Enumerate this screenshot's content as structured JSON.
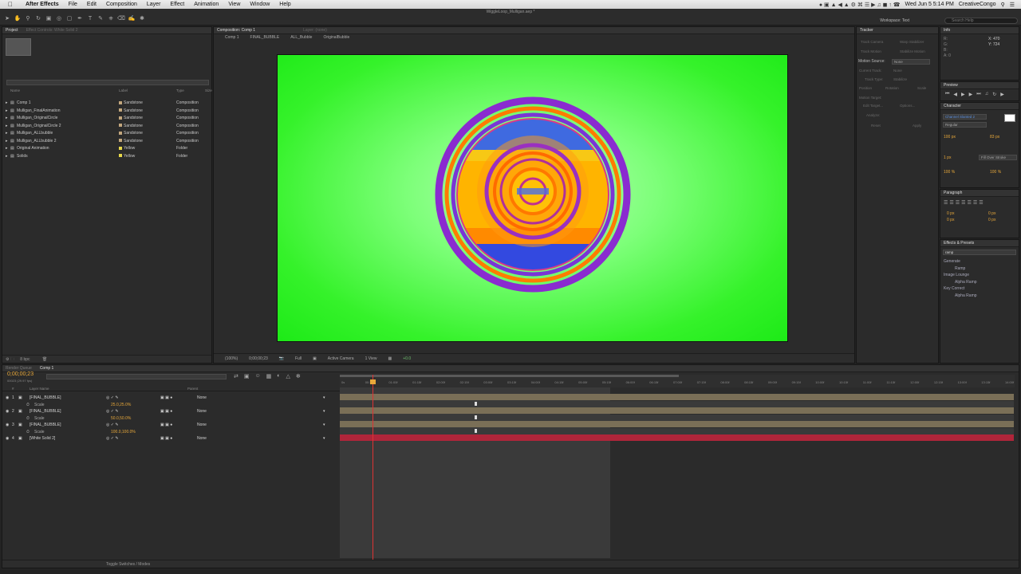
{
  "menubar": {
    "app_name": "After Effects",
    "items": [
      "File",
      "Edit",
      "Composition",
      "Layer",
      "Effect",
      "Animation",
      "View",
      "Window",
      "Help"
    ],
    "clock": "Wed Jun 5 5:14 PM",
    "user": "CreativeCongo"
  },
  "toolbar": {
    "file_title": "WiggleLoop_Mulligan.aep *",
    "workspace_label": "Workspace:",
    "workspace_value": "Text",
    "search_placeholder": "Search Help"
  },
  "project": {
    "tabs": [
      "Project",
      "Effect Controls: White Solid 2"
    ],
    "columns": [
      "Name",
      "Label",
      "Type",
      "Size"
    ],
    "items": [
      {
        "name": "Comp 1",
        "label": "Sandstone",
        "type": "Composition",
        "color": "#c3a77d"
      },
      {
        "name": "Mulligan_FinalAnimation",
        "label": "Sandstone",
        "type": "Composition",
        "color": "#c3a77d"
      },
      {
        "name": "Mulligan_OriginalCircle",
        "label": "Sandstone",
        "type": "Composition",
        "color": "#c3a77d"
      },
      {
        "name": "Mulligan_OriginalCircle 2",
        "label": "Sandstone",
        "type": "Composition",
        "color": "#c3a77d"
      },
      {
        "name": "Mulligan_ALLbubble",
        "label": "Sandstone",
        "type": "Composition",
        "color": "#c3a77d"
      },
      {
        "name": "Mulligan_ALLbubble 2",
        "label": "Sandstone",
        "type": "Composition",
        "color": "#c3a77d"
      },
      {
        "name": "Original Animation",
        "label": "Yellow",
        "type": "Folder",
        "color": "#e8d84a"
      },
      {
        "name": "Solids",
        "label": "Yellow",
        "type": "Folder",
        "color": "#e8d84a"
      }
    ],
    "footer_bpc": "8 bpc"
  },
  "composition": {
    "tabs": [
      "Composition: Comp 1",
      "Layer: (none)"
    ],
    "breadcrumbs": [
      "Comp 1",
      "FINAL_BUBBLE",
      "ALL_Bubble",
      "OriginalBubble"
    ],
    "zoom": "(100%)",
    "timecode": "0;00;00;23",
    "resolution": "Full",
    "camera": "Active Camera",
    "views": "1 View",
    "exposure": "+0.0",
    "bg_color": "#2ff023"
  },
  "tracker": {
    "title": "Tracker",
    "buttons": [
      "Track Camera",
      "Warp Stabilizer",
      "Track Motion",
      "Stabilize Motion"
    ],
    "motion_source_label": "Motion Source:",
    "motion_source_value": "None",
    "current_track_label": "Current Track:",
    "current_track_value": "None",
    "track_type_label": "Track Type:",
    "track_type_value": "Stabilize",
    "checks": [
      "Position",
      "Rotation",
      "Scale"
    ],
    "motion_target": "Motion Target:",
    "edit_target": "Edit Target...",
    "options": "Options...",
    "analyze": "Analyze:",
    "reset": "Reset",
    "apply": "Apply"
  },
  "info": {
    "title": "Info",
    "x": "X: 470",
    "y": "Y: 724",
    "r": "R:",
    "g": "G:",
    "b": "B:",
    "a": "A: 0"
  },
  "preview": {
    "title": "Preview"
  },
  "character": {
    "title": "Character",
    "font": "Channel Slanted 2",
    "style": "Regular",
    "size": "100 px",
    "leading": "83 px",
    "stroke_width": "1 px",
    "stroke_mode": "Fill Over Stroke",
    "vscale": "100 %",
    "hscale": "100 %"
  },
  "paragraph": {
    "title": "Paragraph",
    "indent_values": [
      "0 px",
      "0 px",
      "0 px",
      "0 px"
    ]
  },
  "effects": {
    "title": "Effects & Presets",
    "search_value": "ramp",
    "tree": [
      {
        "text": "Generate",
        "level": 0
      },
      {
        "text": "Ramp",
        "level": 1
      },
      {
        "text": "Image Lounge",
        "level": 0
      },
      {
        "text": "Alpha Ramp",
        "level": 1
      },
      {
        "text": "Key Correct",
        "level": 0
      },
      {
        "text": "Alpha Ramp",
        "level": 1
      }
    ]
  },
  "timeline": {
    "tabs": [
      "Render Queue",
      "Comp 1"
    ],
    "timecode": "0;00;00;23",
    "timecode_sub": "00023 (29.97 fps)",
    "columns": [
      "#",
      "Layer Name",
      "Parent"
    ],
    "ruler_ticks": [
      "0s",
      "00:15f",
      "01:00f",
      "01:15f",
      "02:00f",
      "02:15f",
      "03:00f",
      "03:15f",
      "04:00f",
      "04:15f",
      "05:00f",
      "05:15f",
      "06:00f",
      "06:15f",
      "07:00f",
      "07:15f",
      "08:00f",
      "08:15f",
      "09:00f",
      "09:15f",
      "10:00f",
      "10:15f",
      "11:00f",
      "11:15f",
      "12:00f",
      "12:15f",
      "13:00f",
      "13:15f",
      "14:00f"
    ],
    "layers": [
      {
        "num": "1",
        "name": "[FINAL_BUBBLE]",
        "parent": "None",
        "prop": "Scale",
        "prop_value": "25.0,25.0%"
      },
      {
        "num": "2",
        "name": "[FINAL_BUBBLE]",
        "parent": "None",
        "prop": "Scale",
        "prop_value": "50.0,50.0%"
      },
      {
        "num": "3",
        "name": "[FINAL_BUBBLE]",
        "parent": "None",
        "prop": "Scale",
        "prop_value": "100.0,100.0%"
      },
      {
        "num": "4",
        "name": "[White Solid 2]",
        "parent": "None",
        "prop": "",
        "prop_value": ""
      }
    ],
    "footer": "Toggle Switches / Modes",
    "track_color": "#7a6f57",
    "solid_track_color": "#b0253a"
  }
}
